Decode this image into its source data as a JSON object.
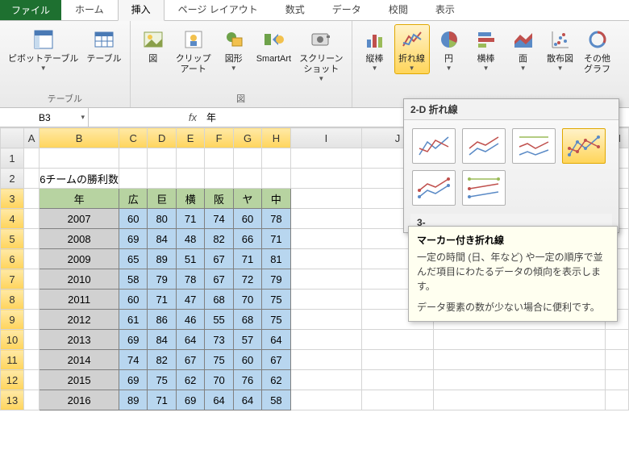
{
  "tabs": {
    "file": "ファイル",
    "list": [
      "ホーム",
      "挿入",
      "ページ レイアウト",
      "数式",
      "データ",
      "校閲",
      "表示"
    ],
    "active_index": 1
  },
  "ribbon": {
    "table_group": {
      "pivot": "ピボットテーブル",
      "table": "テーブル",
      "label": "テーブル"
    },
    "illust_group": {
      "picture": "図",
      "clipart": "クリップ\nアート",
      "shapes": "図形",
      "smartart": "SmartArt",
      "screenshot": "スクリーン\nショット",
      "label": "図"
    },
    "chart_group": {
      "column": "縦棒",
      "line": "折れ線",
      "pie": "円",
      "bar": "横棒",
      "area": "面",
      "scatter": "散布図",
      "other": "その他\nグラフ"
    }
  },
  "formula_bar": {
    "namebox": "B3",
    "fx": "fx",
    "content": "年"
  },
  "grid": {
    "col_letters": [
      "A",
      "B",
      "C",
      "D",
      "E",
      "F",
      "G",
      "H",
      "I",
      "J",
      "N"
    ],
    "row_numbers": [
      1,
      2,
      3,
      4,
      5,
      6,
      7,
      8,
      9,
      10,
      11,
      12,
      13
    ],
    "title_cell": "6チームの勝利数"
  },
  "chart_data": {
    "type": "line",
    "title": "6チームの勝利数",
    "xlabel": "年",
    "categories": [
      2007,
      2008,
      2009,
      2010,
      2011,
      2012,
      2013,
      2014,
      2015,
      2016
    ],
    "series": [
      {
        "name": "広",
        "values": [
          60,
          69,
          65,
          58,
          60,
          61,
          69,
          74,
          69,
          89
        ]
      },
      {
        "name": "巨",
        "values": [
          80,
          84,
          89,
          79,
          71,
          86,
          84,
          82,
          75,
          71
        ]
      },
      {
        "name": "横",
        "values": [
          71,
          48,
          51,
          78,
          47,
          46,
          64,
          67,
          62,
          69
        ]
      },
      {
        "name": "阪",
        "values": [
          74,
          82,
          67,
          67,
          68,
          55,
          73,
          75,
          70,
          64
        ]
      },
      {
        "name": "ヤ",
        "values": [
          60,
          66,
          71,
          72,
          70,
          68,
          57,
          60,
          76,
          64
        ]
      },
      {
        "name": "中",
        "values": [
          78,
          71,
          81,
          79,
          75,
          75,
          64,
          67,
          62,
          58
        ]
      }
    ]
  },
  "gallery": {
    "section1": "2-D 折れ線",
    "section2": "3-"
  },
  "tooltip": {
    "title": "マーカー付き折れ線",
    "line1": "一定の時間 (日、年など) や一定の順序で並んだ項目にわたるデータの傾向を表示します。",
    "line2": "データ要素の数が少ない場合に便利です。"
  }
}
